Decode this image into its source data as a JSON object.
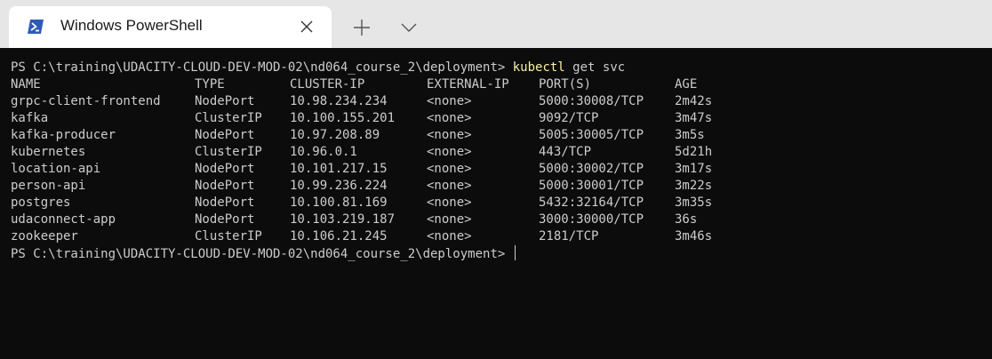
{
  "window": {
    "tab_title": "Windows PowerShell",
    "tab_icon": "powershell-icon",
    "close_icon": "close-icon",
    "new_tab_icon": "plus-icon",
    "dropdown_icon": "chevron-down-icon"
  },
  "terminal": {
    "prompt": "PS C:\\training\\UDACITY-CLOUD-DEV-MOD-02\\nd064_course_2\\deployment> ",
    "command_name": "kubectl",
    "command_args": " get svc",
    "headers": [
      "NAME",
      "TYPE",
      "CLUSTER-IP",
      "EXTERNAL-IP",
      "PORT(S)",
      "AGE"
    ],
    "rows": [
      [
        "grpc-client-frontend",
        "NodePort",
        "10.98.234.234",
        "<none>",
        "5000:30008/TCP",
        "2m42s"
      ],
      [
        "kafka",
        "ClusterIP",
        "10.100.155.201",
        "<none>",
        "9092/TCP",
        "3m47s"
      ],
      [
        "kafka-producer",
        "NodePort",
        "10.97.208.89",
        "<none>",
        "5005:30005/TCP",
        "3m5s"
      ],
      [
        "kubernetes",
        "ClusterIP",
        "10.96.0.1",
        "<none>",
        "443/TCP",
        "5d21h"
      ],
      [
        "location-api",
        "NodePort",
        "10.101.217.15",
        "<none>",
        "5000:30002/TCP",
        "3m17s"
      ],
      [
        "person-api",
        "NodePort",
        "10.99.236.224",
        "<none>",
        "5000:30001/TCP",
        "3m22s"
      ],
      [
        "postgres",
        "NodePort",
        "10.100.81.169",
        "<none>",
        "5432:32164/TCP",
        "3m35s"
      ],
      [
        "udaconnect-app",
        "NodePort",
        "10.103.219.187",
        "<none>",
        "3000:30000/TCP",
        "36s"
      ],
      [
        "zookeeper",
        "ClusterIP",
        "10.106.21.245",
        "<none>",
        "2181/TCP",
        "3m46s"
      ]
    ],
    "final_prompt": "PS C:\\training\\UDACITY-CLOUD-DEV-MOD-02\\nd064_course_2\\deployment> "
  },
  "colors": {
    "terminal_bg": "#0c0c0c",
    "terminal_text": "#cccccc",
    "command_highlight": "#f9f1a5",
    "titlebar_bg": "#e6e6e6",
    "tab_bg": "#ffffff",
    "powershell_blue": "#2f5bb7"
  }
}
